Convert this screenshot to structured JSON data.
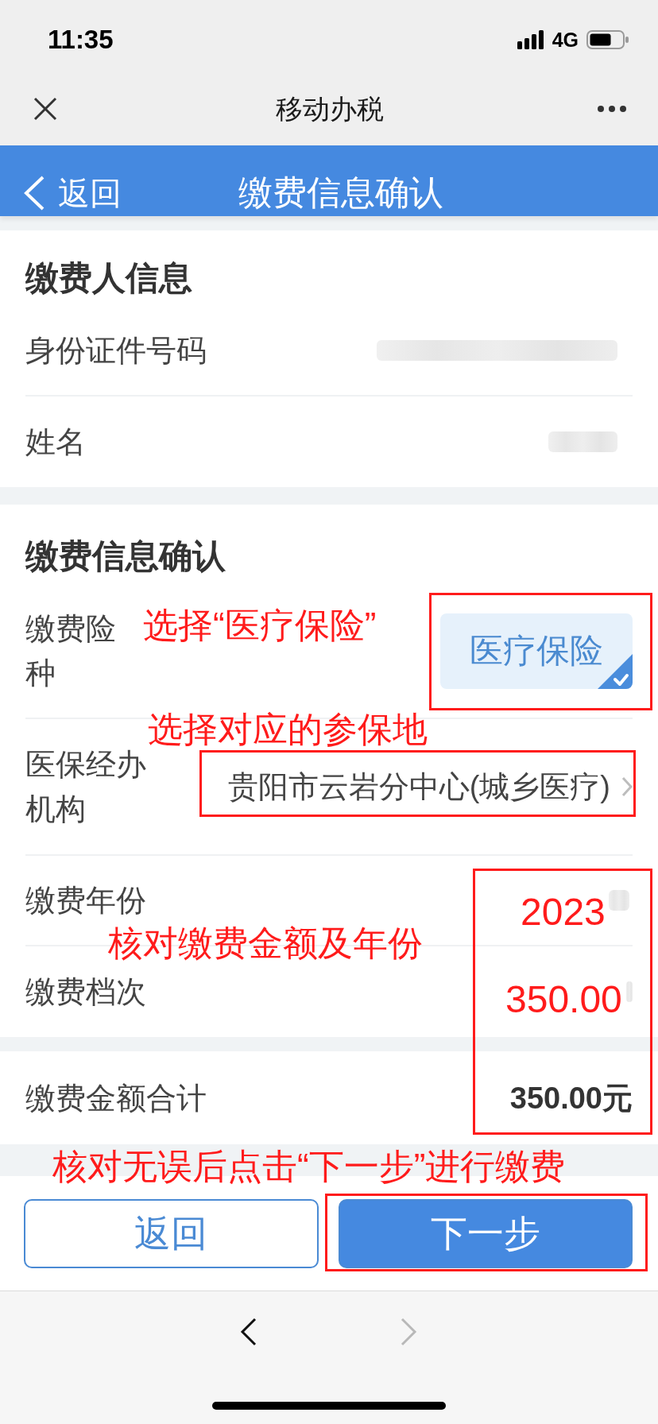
{
  "status_bar": {
    "time": "11:35",
    "network": "4G"
  },
  "app_bar": {
    "title": "移动办税"
  },
  "header": {
    "back": "返回",
    "title": "缴费信息确认"
  },
  "payer_section": {
    "heading": "缴费人信息",
    "rows": [
      {
        "kind": "redacted",
        "label": "身份证件号码"
      },
      {
        "kind": "redacted",
        "label": "姓名"
      }
    ]
  },
  "payment_section": {
    "heading": "缴费信息确认",
    "rows": [
      {
        "kind": "option",
        "label": "缴费险种",
        "option": {
          "text": "医疗保险",
          "selected": true
        }
      },
      {
        "kind": "select",
        "label": "医保经办机构",
        "value": "贵阳市云岩分中心(城乡医疗)"
      },
      {
        "kind": "redacted",
        "label": "缴费年份"
      },
      {
        "kind": "redacted",
        "label": "缴费档次"
      }
    ]
  },
  "total_section": {
    "label": "缴费金额合计",
    "value": "350.00元"
  },
  "buttons": [
    {
      "kind": "secondary",
      "label": "返回"
    },
    {
      "kind": "primary",
      "label": "下一步"
    }
  ],
  "browser_nav": [
    {
      "kind": "back",
      "disabled": false
    },
    {
      "kind": "forward",
      "disabled": true
    }
  ],
  "annotations": [
    {
      "kind": "note",
      "text": "选择“医疗保险”"
    },
    {
      "kind": "frame"
    },
    {
      "kind": "note",
      "text": "选择对应的参保地"
    },
    {
      "kind": "frame"
    },
    {
      "kind": "frame"
    },
    {
      "kind": "note",
      "text": "2023"
    },
    {
      "kind": "note",
      "text": "核对缴费金额及年份"
    },
    {
      "kind": "note",
      "text": "350.00"
    },
    {
      "kind": "note",
      "text": "核对无误后点击“下一步”进行缴费"
    },
    {
      "kind": "frame"
    }
  ]
}
